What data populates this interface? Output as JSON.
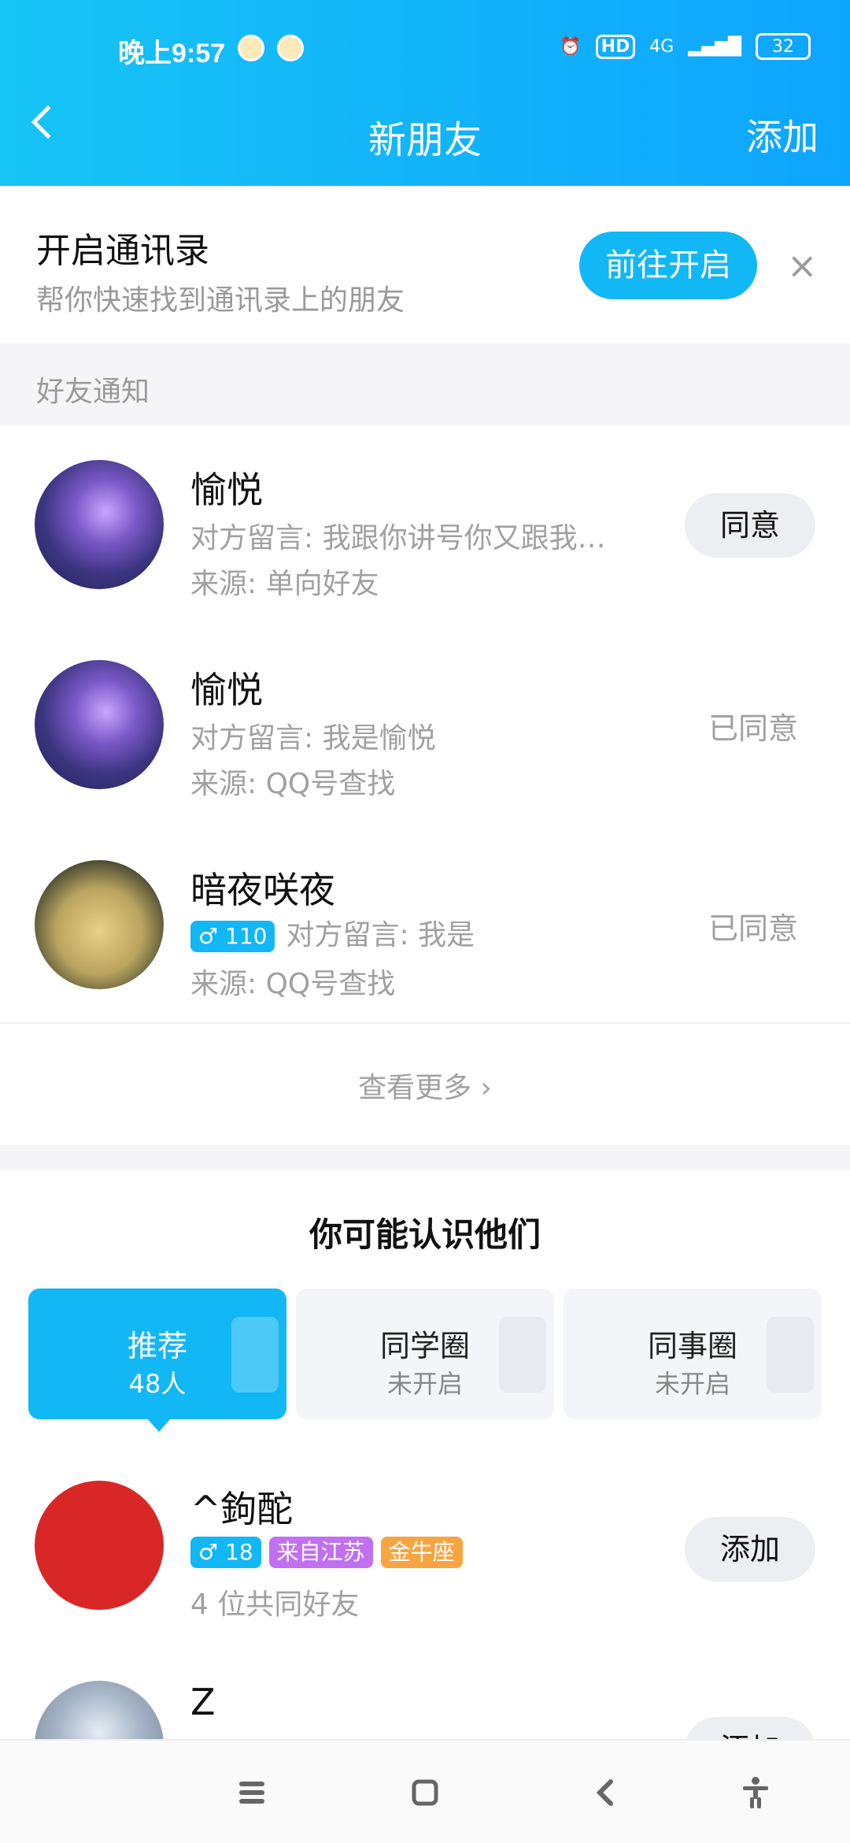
{
  "status_bar": {
    "time": "晚上9:57",
    "network": "4G",
    "hd": "HD",
    "battery": "32"
  },
  "header": {
    "title": "新朋友",
    "add_label": "添加"
  },
  "contacts_promo": {
    "title": "开启通讯录",
    "subtitle": "帮你快速找到通讯录上的朋友",
    "button_label": "前往开启",
    "close": "×"
  },
  "friend_notice": {
    "section_label": "好友通知",
    "items": [
      {
        "name": "愉悦",
        "message": "对方留言: 我跟你讲号你又跟我…",
        "source": "来源: 单向好友",
        "action": "同意"
      },
      {
        "name": "愉悦",
        "message": "对方留言: 我是愉悦",
        "source": "来源: QQ号查找",
        "status": "已同意"
      },
      {
        "name": "暗夜咲夜",
        "gender_age": "♂ 110",
        "message": "对方留言: 我是",
        "source": "来源: QQ号查找",
        "status": "已同意"
      }
    ],
    "view_more": "查看更多 ›"
  },
  "maybe_know": {
    "title": "你可能认识他们",
    "cards": [
      {
        "title": "推荐",
        "sub": "48人"
      },
      {
        "title": "同学圈",
        "sub": "未开启"
      },
      {
        "title": "同事圈",
        "sub": "未开启"
      }
    ],
    "people": [
      {
        "name": "^鉤酡",
        "gender_age": "♂ 18",
        "location": "来自江苏",
        "zodiac": "金牛座",
        "mutual": "4 位共同好友",
        "action": "添加"
      },
      {
        "name": "Z",
        "action": "添加"
      }
    ]
  },
  "colors": {
    "accent": "#12b7f5",
    "tag_purple": "#c070f0",
    "tag_orange": "#f7a442"
  }
}
